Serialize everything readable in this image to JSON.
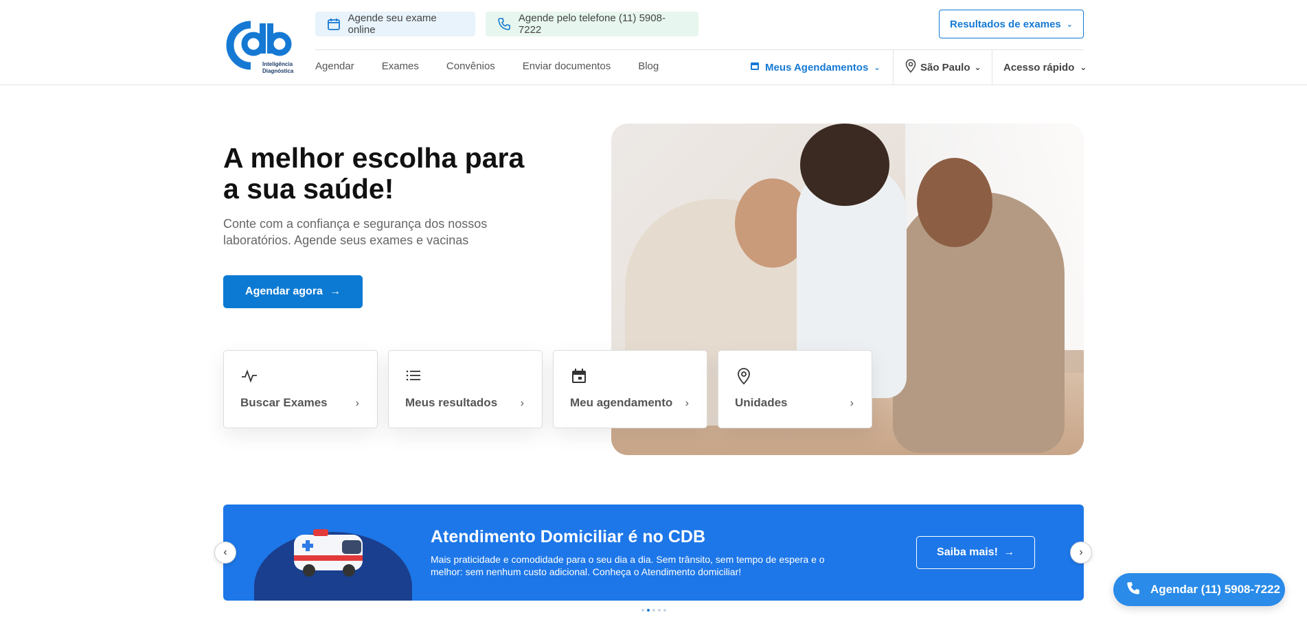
{
  "header": {
    "logo_text_line1": "Inteligência",
    "logo_text_line2": "Diagnóstica",
    "chip_online": "Agende seu exame online",
    "chip_phone": "Agende pelo telefone (11) 5908-7222",
    "results_button": "Resultados de exames",
    "nav": [
      "Agendar",
      "Exames",
      "Convênios",
      "Enviar documentos",
      "Blog"
    ],
    "meus_agendamentos": "Meus Agendamentos",
    "location": "São Paulo",
    "acesso_rapido": "Acesso rápido"
  },
  "hero": {
    "title": "A melhor escolha para a sua saúde!",
    "subtitle": "Conte com a confiança e segurança dos nossos laboratórios. Agende seus exames e vacinas",
    "cta": "Agendar agora"
  },
  "cards": [
    {
      "label": "Buscar Exames",
      "icon": "activity-icon"
    },
    {
      "label": "Meus resultados",
      "icon": "list-icon"
    },
    {
      "label": "Meu agendamento",
      "icon": "calendar-icon"
    },
    {
      "label": "Unidades",
      "icon": "location-pin-icon"
    }
  ],
  "banner": {
    "title": "Atendimento Domiciliar é no CDB",
    "text": "Mais praticidade e comodidade para o seu dia a dia. Sem trânsito, sem tempo de espera e o melhor: sem nenhum custo adicional. Conheça o Atendimento domiciliar!",
    "button": "Saiba mais!",
    "slides_total": 5,
    "slide_active": 2
  },
  "floating": {
    "label": "Agendar (11) 5908-7222"
  },
  "colors": {
    "primary": "#0c7ad3",
    "banner": "#1d77e8",
    "floating": "#2a8be8"
  }
}
